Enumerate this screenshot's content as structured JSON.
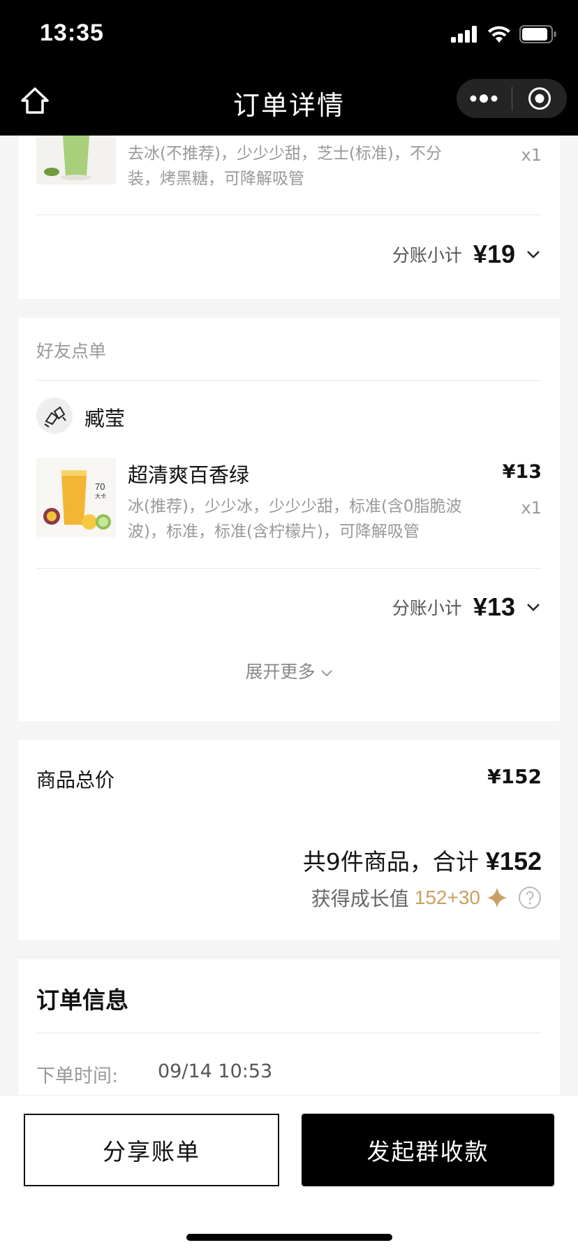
{
  "status_bar": {
    "time": "13:35"
  },
  "nav": {
    "title": "订单详情"
  },
  "my_order": {
    "item": {
      "spec": "去冰(不推荐)，少少少甜，芝士(标准)，不分装，烤黑糖，可降解吸管",
      "qty": "x1"
    },
    "subtotal_label": "分账小计",
    "subtotal_value": "¥19"
  },
  "friend_order": {
    "section_label": "好友点单",
    "friend_name": "臧莹",
    "item": {
      "name": "超清爽百香绿",
      "price": "¥13",
      "qty": "x1",
      "spec": "冰(推荐)，少少冰，少少少甜，标准(含0脂脆波波)，标准，标准(含柠檬片)，可降解吸管",
      "thumb_text_1": "70",
      "thumb_text_2": "大卡"
    },
    "subtotal_label": "分账小计",
    "subtotal_value": "¥13",
    "expand_more": "展开更多"
  },
  "summary": {
    "total_label": "商品总价",
    "total_value": "¥152",
    "count_text": "共9件商品，合计",
    "sum_value": "¥152",
    "growth_label": "获得成长值",
    "growth_value": "152+30",
    "accent": "#c9a063"
  },
  "order_info": {
    "title": "订单信息",
    "time_label": "下单时间:",
    "time_value": "09/14 10:53"
  },
  "actions": {
    "share_label": "分享账单",
    "collect_label": "发起群收款"
  }
}
